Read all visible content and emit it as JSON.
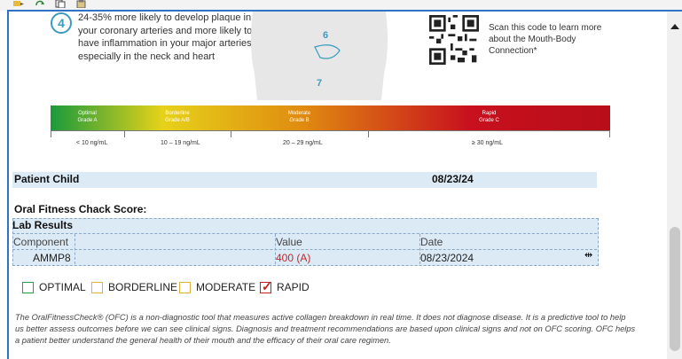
{
  "toolbar": {
    "icons": [
      "highlight-icon",
      "refresh-icon",
      "copy-icon",
      "paste-icon"
    ]
  },
  "infographic": {
    "step_number": "4",
    "step_text": "24-35% more likely to develop plaque in your coronary arteries and more likely to have inflammation in your major arteries, especially in the neck and heart",
    "figure_numbers": [
      "6",
      "7"
    ],
    "scan_text": "Scan this code to learn more about the Mouth-Body Connection*",
    "scale": {
      "segments": [
        {
          "label": "Optimal",
          "sub": "Grade A"
        },
        {
          "label": "Borderline",
          "sub": "Grade A/B"
        },
        {
          "label": "Moderate",
          "sub": "Grade B"
        },
        {
          "label": "Rapid",
          "sub": "Grade C"
        }
      ],
      "ticks": [
        "< 10 ng/mL",
        "10 – 19 ng/mL",
        "20 – 29 ng/mL",
        "≥ 30 ng/mL"
      ],
      "colors": [
        "#1a9a3c",
        "#e6d21a",
        "#e08b10",
        "#c8101e"
      ]
    }
  },
  "form": {
    "patient_name": "Patient Child",
    "date": "08/23/24",
    "score_title": "Oral Fitness Chack Score:",
    "lab_title": "Lab Results",
    "columns": [
      "Component",
      "Value",
      "Date"
    ],
    "row": {
      "component": "AMMP8",
      "value": "400 (A)",
      "date": "08/23/2024"
    },
    "value_color": "#c0282d",
    "grades": [
      {
        "label": "OPTIMAL",
        "checked": false,
        "color": "#2e9e44"
      },
      {
        "label": "BORDERLINE",
        "checked": false,
        "color": "#e2b23a"
      },
      {
        "label": "MODERATE",
        "checked": false,
        "color": "#e2b23a"
      },
      {
        "label": "RAPID",
        "checked": true,
        "color": "#c81e1e"
      }
    ],
    "footnote": "The OralFitnessCheck® (OFC) is a non-diagnostic tool that measures active collagen breakdown in real time. It does not diagnose disease. It is a predictive tool to help us better assess outcomes before we can see clinical signs. Diagnosis and treatment recommendations are based upon clinical signs and not on OFC scoring. OFC helps a patient better understand the general health of their mouth and the efficacy of their oral care regimen."
  }
}
